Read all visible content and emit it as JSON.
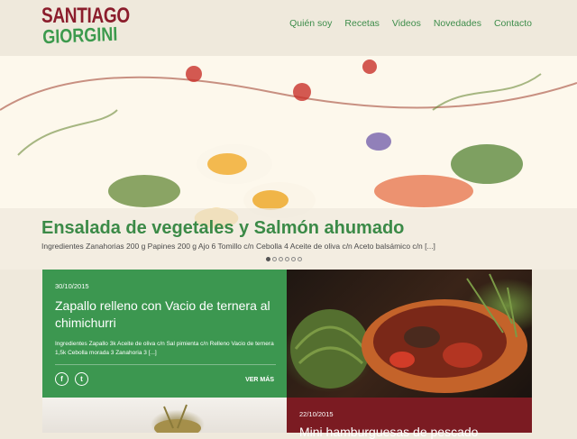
{
  "logo": {
    "line1": "SANTIAGO",
    "line2": "GIORGINI"
  },
  "nav": [
    "Quién soy",
    "Recetas",
    "Videos",
    "Novedades",
    "Contacto"
  ],
  "hero": {
    "title": "Ensalada de vegetales y Salmón ahumado",
    "text": "Ingredientes Zanahorias 200 g Papines 200 g Ajo 6 Tomillo c/n Cebolla 4 Aceite de oliva c/n Aceto balsámico c/n [...]",
    "slide_count": 6,
    "active_slide": 1
  },
  "post1": {
    "date": "30/10/2015",
    "title": "Zapallo relleno con Vacio de ternera al chimichurri",
    "excerpt": "Ingredientes Zapallo 3k Aceite de oliva c/n Sal pimienta c/n Relleno Vacio de ternera 1,5k Cebolla morada 3 Zanahoria 3 [...]",
    "share_facebook": "f",
    "share_twitter": "t",
    "read_more": "VER MÁS"
  },
  "post2": {
    "date": "22/10/2015",
    "title": "Mini hamburguesas de pescado"
  },
  "colors": {
    "green": "#3c9750",
    "red": "#7b1b22",
    "nav": "#3e8d4b",
    "logo_red": "#8b1d2c"
  }
}
